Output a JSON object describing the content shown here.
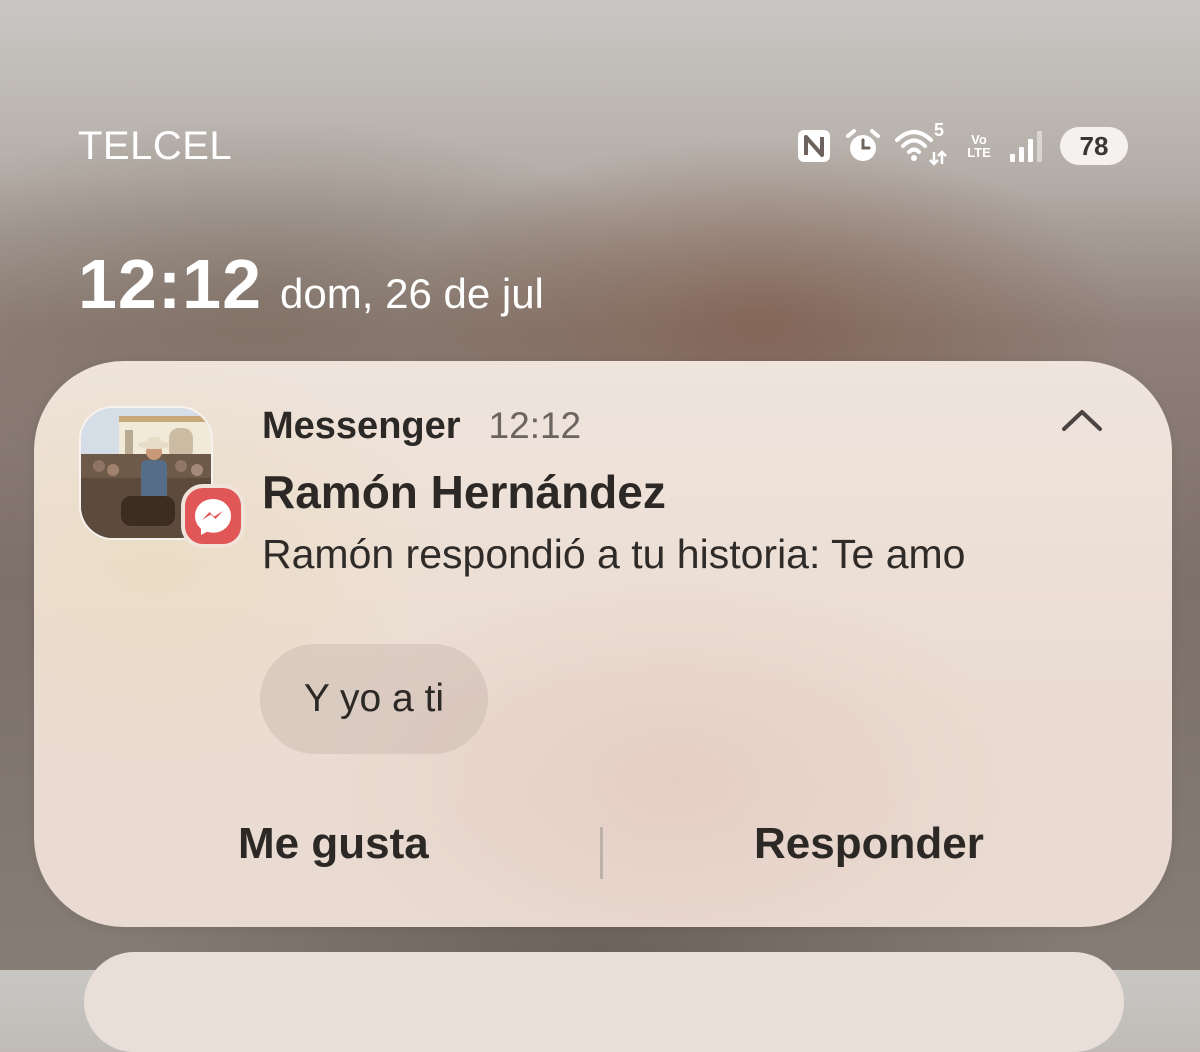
{
  "status_bar": {
    "carrier": "TELCEL",
    "icons": [
      "nfc-icon",
      "alarm-icon",
      "wifi-icon",
      "volte-icon",
      "signal-icon"
    ],
    "wifi_band": "5",
    "volte_top": "Vo",
    "volte_bottom": "LTE",
    "battery": "78"
  },
  "lockscreen": {
    "time": "12:12",
    "date": "dom, 26 de jul"
  },
  "notification": {
    "app_name": "Messenger",
    "time": "12:12",
    "sender": "Ramón Hernández",
    "message": "Ramón respondió a tu historia: Te amo",
    "quick_reply": "Y yo a ti",
    "actions": {
      "like": "Me gusta",
      "reply": "Responder"
    },
    "badge_color": "#e15656"
  }
}
